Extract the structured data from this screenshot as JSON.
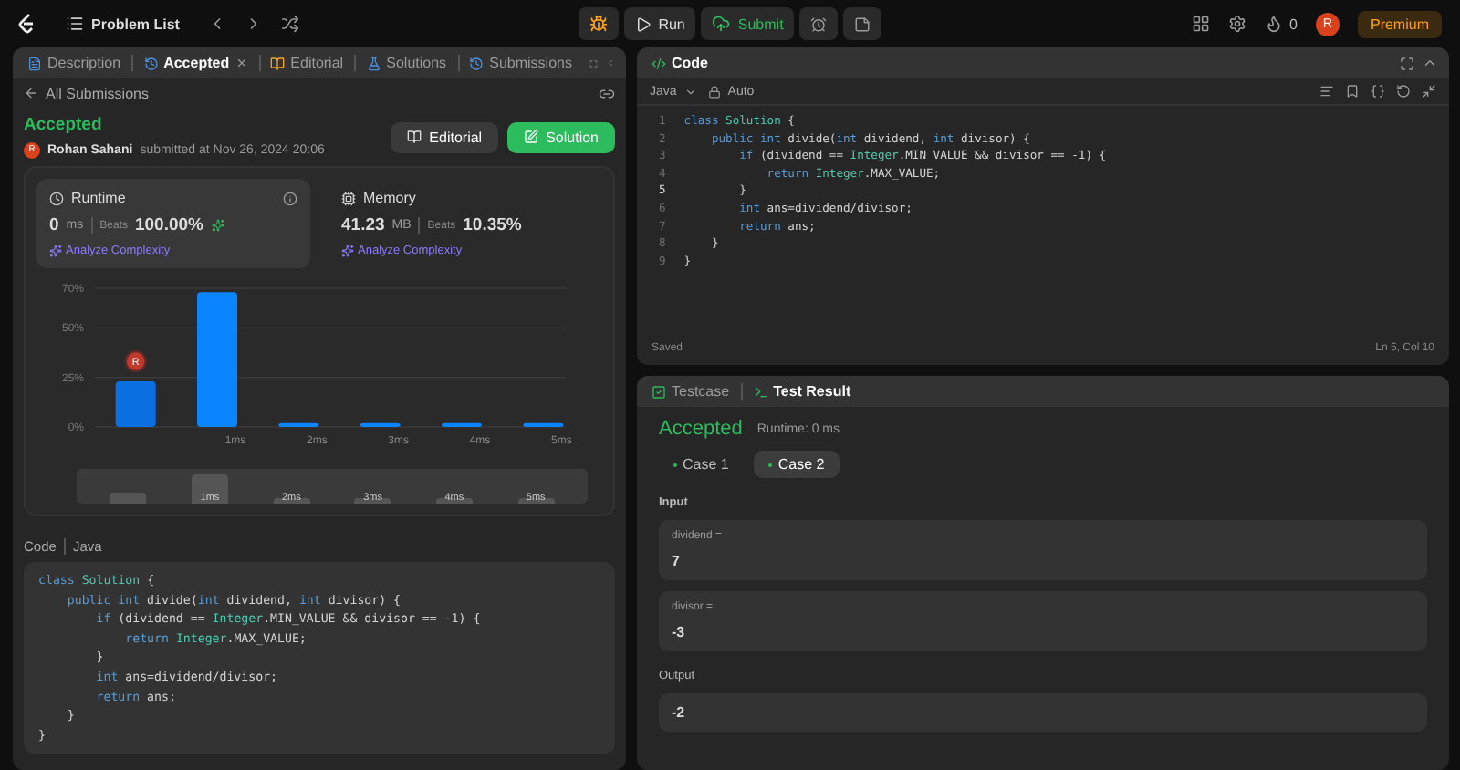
{
  "topbar": {
    "problem_list": "Problem List",
    "run": "Run",
    "submit": "Submit",
    "streak": "0",
    "avatar": "R",
    "premium": "Premium"
  },
  "left_tabs": [
    {
      "label": "Description",
      "selected": false,
      "closable": false
    },
    {
      "label": "Accepted",
      "selected": true,
      "closable": true
    },
    {
      "label": "Editorial",
      "selected": false,
      "closable": false
    },
    {
      "label": "Solutions",
      "selected": false,
      "closable": false
    },
    {
      "label": "Submissions",
      "selected": false,
      "closable": false
    }
  ],
  "back_link": "All Submissions",
  "submission": {
    "status": "Accepted",
    "avatar": "R",
    "user": "Rohan Sahani",
    "submitted": "submitted at Nov 26, 2024 20:06",
    "buttons": [
      {
        "label": "Editorial",
        "kind": "secondary"
      },
      {
        "label": "Solution",
        "kind": "primary"
      }
    ]
  },
  "stats": [
    {
      "title": "Runtime",
      "kind": "runtime",
      "selected": true,
      "value": "0",
      "unit": "ms",
      "beats_label": "Beats",
      "beats": "100.00%",
      "analyze": "Analyze Complexity"
    },
    {
      "title": "Memory",
      "kind": "memory",
      "selected": false,
      "value": "41.23",
      "unit": "MB",
      "beats_label": "Beats",
      "beats": "10.35%",
      "analyze": "Analyze Complexity"
    }
  ],
  "chart_data": {
    "type": "bar",
    "categories": [
      null,
      "1ms",
      "2ms",
      "3ms",
      "4ms",
      "5ms"
    ],
    "values": [
      23,
      68,
      2,
      2,
      2,
      2
    ],
    "ylim": [
      0,
      70
    ],
    "grid": true,
    "yticks": [
      {
        "value": 0,
        "label": "0%"
      },
      {
        "value": 25,
        "label": "25%"
      },
      {
        "value": 50,
        "label": "50%"
      },
      {
        "value": 70,
        "label": "70%"
      }
    ]
  },
  "chart_marker": "R",
  "range_selector": {
    "labels": [
      "1ms",
      "2ms",
      "3ms",
      "4ms",
      "5ms"
    ]
  },
  "code_section": {
    "title": "Code",
    "language": "Java",
    "lines": [
      [
        {
          "kind": "kw",
          "text": "class "
        },
        {
          "kind": "cls",
          "text": "Solution"
        },
        {
          "kind": "p",
          "text": " {"
        }
      ],
      [
        {
          "kind": "kw",
          "text": "    public int "
        },
        {
          "kind": "p",
          "text": "divide("
        },
        {
          "kind": "kw",
          "text": "int "
        },
        {
          "kind": "p",
          "text": "dividend, "
        },
        {
          "kind": "kw",
          "text": "int "
        },
        {
          "kind": "p",
          "text": "divisor) {"
        }
      ],
      [
        {
          "kind": "kw",
          "text": "        if "
        },
        {
          "kind": "p",
          "text": "(dividend == "
        },
        {
          "kind": "cls",
          "text": "Integer"
        },
        {
          "kind": "p",
          "text": ".MIN_VALUE && divisor == -1) {"
        }
      ],
      [
        {
          "kind": "kw",
          "text": "            return "
        },
        {
          "kind": "cls",
          "text": "Integer"
        },
        {
          "kind": "p",
          "text": ".MAX_VALUE;"
        }
      ],
      [
        {
          "kind": "p",
          "text": "        }"
        }
      ],
      [
        {
          "kind": "kw",
          "text": "        int "
        },
        {
          "kind": "p",
          "text": "ans=dividend/divisor;"
        }
      ],
      [
        {
          "kind": "kw",
          "text": "        return "
        },
        {
          "kind": "p",
          "text": "ans;"
        }
      ],
      [
        {
          "kind": "p",
          "text": "    }"
        }
      ],
      [
        {
          "kind": "p",
          "text": "}"
        }
      ]
    ]
  },
  "editor": {
    "title": "Code",
    "language": "Java",
    "mode": "Auto",
    "status": "Saved",
    "position": "Ln 5, Col 10",
    "lines": [
      [
        {
          "kind": "kw",
          "text": "class "
        },
        {
          "kind": "cls",
          "text": "Solution"
        },
        {
          "kind": "p",
          "text": " {"
        }
      ],
      [
        {
          "kind": "kw",
          "text": "    public int "
        },
        {
          "kind": "p",
          "text": "divide("
        },
        {
          "kind": "kw",
          "text": "int "
        },
        {
          "kind": "p",
          "text": "dividend, "
        },
        {
          "kind": "kw",
          "text": "int "
        },
        {
          "kind": "p",
          "text": "divisor) {"
        }
      ],
      [
        {
          "kind": "kw",
          "text": "        if "
        },
        {
          "kind": "p",
          "text": "(dividend == "
        },
        {
          "kind": "cls",
          "text": "Integer"
        },
        {
          "kind": "p",
          "text": ".MIN_VALUE && divisor == -1) {"
        }
      ],
      [
        {
          "kind": "kw",
          "text": "            return "
        },
        {
          "kind": "cls",
          "text": "Integer"
        },
        {
          "kind": "p",
          "text": ".MAX_VALUE;"
        }
      ],
      [
        {
          "kind": "p",
          "text": "        }"
        }
      ],
      [
        {
          "kind": "kw",
          "text": "        int "
        },
        {
          "kind": "p",
          "text": "ans=dividend/divisor;"
        }
      ],
      [
        {
          "kind": "kw",
          "text": "        return "
        },
        {
          "kind": "p",
          "text": "ans;"
        }
      ],
      [
        {
          "kind": "p",
          "text": "    }"
        }
      ],
      [
        {
          "kind": "p",
          "text": "}"
        }
      ]
    ],
    "line_numbers": [
      {
        "number": "1",
        "current": false
      },
      {
        "number": "2",
        "current": false
      },
      {
        "number": "3",
        "current": false
      },
      {
        "number": "4",
        "current": false
      },
      {
        "number": "5",
        "current": true
      },
      {
        "number": "6",
        "current": false
      },
      {
        "number": "7",
        "current": false
      },
      {
        "number": "8",
        "current": false
      },
      {
        "number": "9",
        "current": false
      }
    ]
  },
  "bottom_tabs": [
    {
      "label": "Testcase",
      "selected": false
    },
    {
      "label": "Test Result",
      "selected": true
    }
  ],
  "result": {
    "status": "Accepted",
    "runtime": "Runtime: 0 ms",
    "cases": [
      {
        "label": "Case 1",
        "selected": false
      },
      {
        "label": "Case 2",
        "selected": true
      }
    ],
    "input_label": "Input",
    "inputs": [
      {
        "name": "dividend =",
        "value": "7"
      },
      {
        "name": "divisor =",
        "value": "-3"
      }
    ],
    "output_label": "Output",
    "output": "-2"
  }
}
